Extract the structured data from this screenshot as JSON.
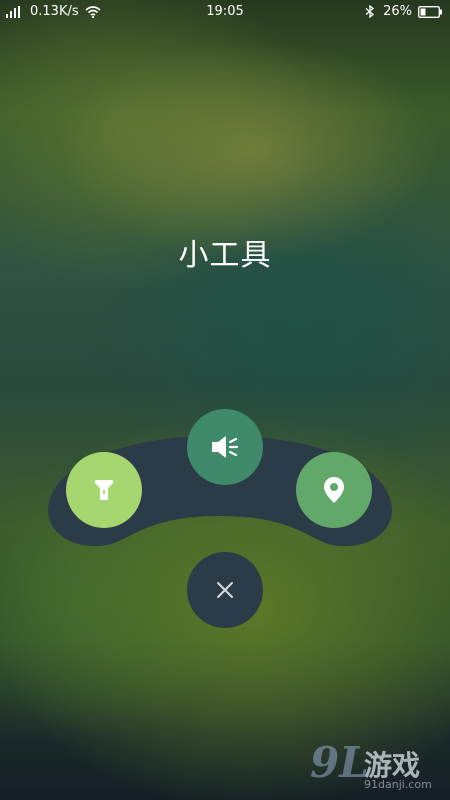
{
  "status_bar": {
    "net_speed": "0.13K/s",
    "time": "19:05",
    "battery": "26%",
    "icons": [
      "signal-icon",
      "wifi-icon",
      "bluetooth-icon",
      "battery-icon"
    ]
  },
  "title": "小工具",
  "tools": [
    {
      "name": "flashlight",
      "icon": "flashlight-icon",
      "color": "#a6d66f"
    },
    {
      "name": "sound",
      "icon": "speaker-icon",
      "color": "#3f8a6a"
    },
    {
      "name": "location",
      "icon": "location-pin-icon",
      "color": "#62a86a"
    }
  ],
  "close_button": {
    "icon": "close-icon",
    "color": "#2c3b48"
  },
  "arc_color": "#2c3b48",
  "watermark": {
    "logo": "9L",
    "text": "游戏",
    "url": "91danji.com"
  }
}
